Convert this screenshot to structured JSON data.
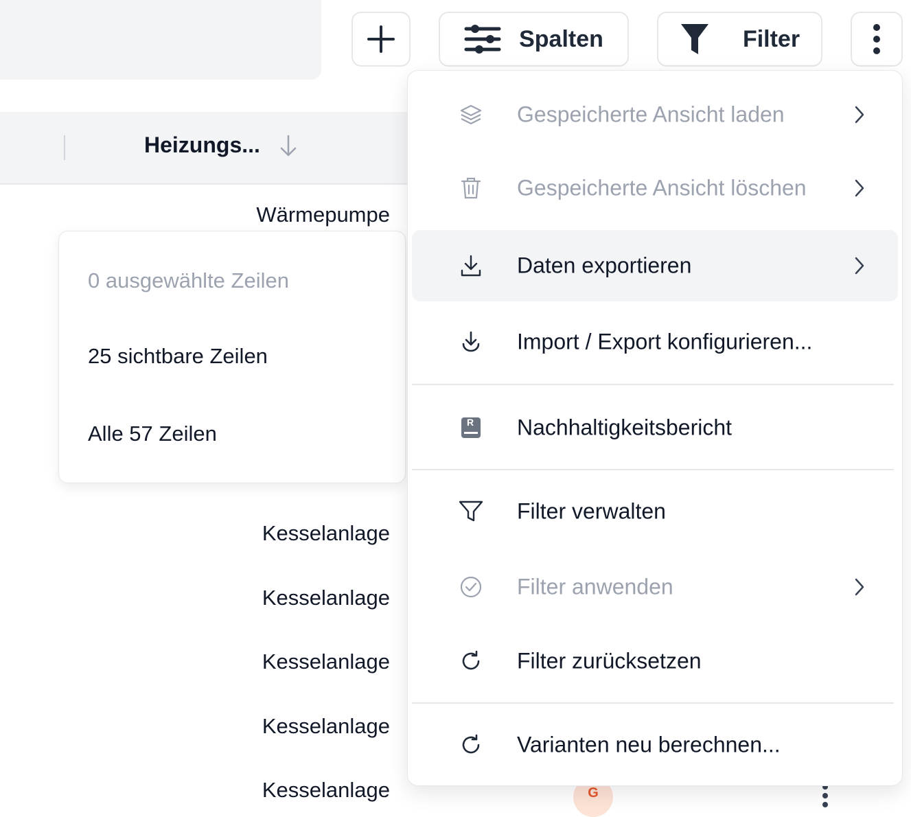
{
  "toolbar": {
    "columns_label": "Spalten",
    "filter_label": "Filter",
    "icons": {
      "add": "plus-icon",
      "columns": "sliders-icon",
      "filter": "funnel-icon",
      "more": "kebab-icon"
    }
  },
  "table": {
    "column_header": "Heizungs...",
    "rows": [
      "Wärmepumpe",
      "Kesselanlage",
      "Kesselanlage",
      "Kesselanlage",
      "Kesselanlage",
      "Kesselanlage"
    ],
    "avatar_initial": "G"
  },
  "export_submenu": {
    "items": [
      {
        "label": "0 ausgewählte Zeilen",
        "disabled": true
      },
      {
        "label": "25 sichtbare Zeilen",
        "disabled": false
      },
      {
        "label": "Alle 57 Zeilen",
        "disabled": false
      }
    ]
  },
  "menu": {
    "items": [
      {
        "label": "Gespeicherte Ansicht laden",
        "icon": "layers-icon",
        "disabled": true,
        "submenu": true
      },
      {
        "label": "Gespeicherte Ansicht löschen",
        "icon": "trash-icon",
        "disabled": true,
        "submenu": true
      },
      {
        "label": "Daten exportieren",
        "icon": "download-icon",
        "disabled": false,
        "submenu": true,
        "active": true
      },
      {
        "label": "Import / Export konfigurieren...",
        "icon": "import-export-icon",
        "disabled": false,
        "submenu": false
      },
      {
        "label": "Nachhaltigkeitsbericht",
        "icon": "report-icon",
        "report_letter": "R",
        "disabled": false,
        "submenu": false
      },
      {
        "label": "Filter verwalten",
        "icon": "filter-outline-icon",
        "disabled": false,
        "submenu": false
      },
      {
        "label": "Filter anwenden",
        "icon": "check-circle-icon",
        "disabled": true,
        "submenu": true
      },
      {
        "label": "Filter zurücksetzen",
        "icon": "refresh-icon",
        "disabled": false,
        "submenu": false
      },
      {
        "label": "Varianten neu berechnen...",
        "icon": "refresh-icon",
        "disabled": false,
        "submenu": false
      }
    ]
  },
  "colors": {
    "accent_avatar_bg": "#fde2d6",
    "accent_avatar_fg": "#e5572a",
    "disabled_text": "#9ca3af",
    "active_bg": "#f3f4f6"
  }
}
